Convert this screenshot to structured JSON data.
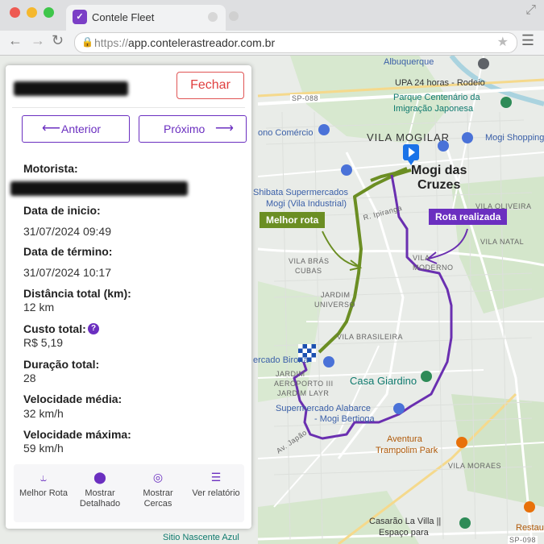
{
  "browser": {
    "tab_title": "Contele Fleet",
    "url_protocol": "https://",
    "url_host": "app.contelerastreador.com.br",
    "colors": {
      "close": "#ee5a52",
      "minimize": "#f5b82e",
      "maximize": "#3ec64a"
    }
  },
  "panel": {
    "close_label": "Fechar",
    "prev_label": "Anterior",
    "next_label": "Próximo",
    "fields": {
      "driver_label": "Motorista:",
      "start_label": "Data de inicio:",
      "start_value": "31/07/2024 09:49",
      "end_label": "Data de término:",
      "end_value": "31/07/2024 10:17",
      "distance_label": "Distância total (km):",
      "distance_value": "12 km",
      "cost_label": "Custo total:",
      "cost_value": "R$ 5,19",
      "duration_label": "Duração total:",
      "duration_value": "28",
      "avg_speed_label": "Velocidade média:",
      "avg_speed_value": "32 km/h",
      "max_speed_label": "Velocidade máxima:",
      "max_speed_value": "59 km/h"
    },
    "footer": [
      {
        "label": "Melhor Rota",
        "icon": "route-icon"
      },
      {
        "label": "Mostrar Detalhado",
        "icon": "location-pin-icon"
      },
      {
        "label": "Mostrar Cercas",
        "icon": "fence-target-icon"
      },
      {
        "label": "Ver relatório",
        "icon": "list-icon"
      }
    ],
    "accent": "#6b2fc0"
  },
  "map": {
    "callout_best": "Melhor rota",
    "callout_actual": "Rota realizada",
    "route_colors": {
      "best": "#6b8e23",
      "actual": "#6a2fb0"
    },
    "labels": {
      "albuquerque": "Albuquerque",
      "upa": "UPA 24 horas - Rodeio",
      "parque1": "Parque Centenário da",
      "parque2": "Imigração Japonesa",
      "sp088": "SP-088",
      "vila_mogilar": "VILA MOGILAR",
      "ono": "ono Comércio",
      "mogi_shopping": "Mogi Shopping",
      "mogi1": "Mogi das",
      "mogi2": "Cruzes",
      "shibata1": "Shibata Supermercados",
      "shibata2": "Mogi (Vila Industrial)",
      "ipiranga": "R. Ipiranga",
      "vila_oliveira": "VILA OLIVEIRA",
      "vila_natal": "VILA NATAL",
      "vila_bras1": "VILA BRÁS",
      "vila_bras2": "CUBAS",
      "vila_moderno1": "VILA",
      "vila_moderno2": "MODERNO",
      "jardim1": "JARDIM",
      "jardim2": "UNIVERSO",
      "vila_brasileira": "VILA BRASILEIRA",
      "birona": "ercado Birona",
      "jardim_aero1": "JARDIM",
      "jardim_aero2": "AEROPORTO III",
      "jardim_layr": "JARDIM LAYR",
      "casa_giardino": "Casa Giardino",
      "alabarce1": "Supermercado Alabarce",
      "alabarce2": "- Mogi Bertioga",
      "av_japao": "Av. Japão",
      "aventura1": "Aventura",
      "aventura2": "Trampolim Park",
      "vila_moraes": "VILA MORAES",
      "casarao1": "Casarão La Villa ||",
      "casarao2": "Espaço para",
      "restau": "Restau",
      "sitio": "Sitio Nascente Azul",
      "sp098": "SP-098"
    }
  }
}
